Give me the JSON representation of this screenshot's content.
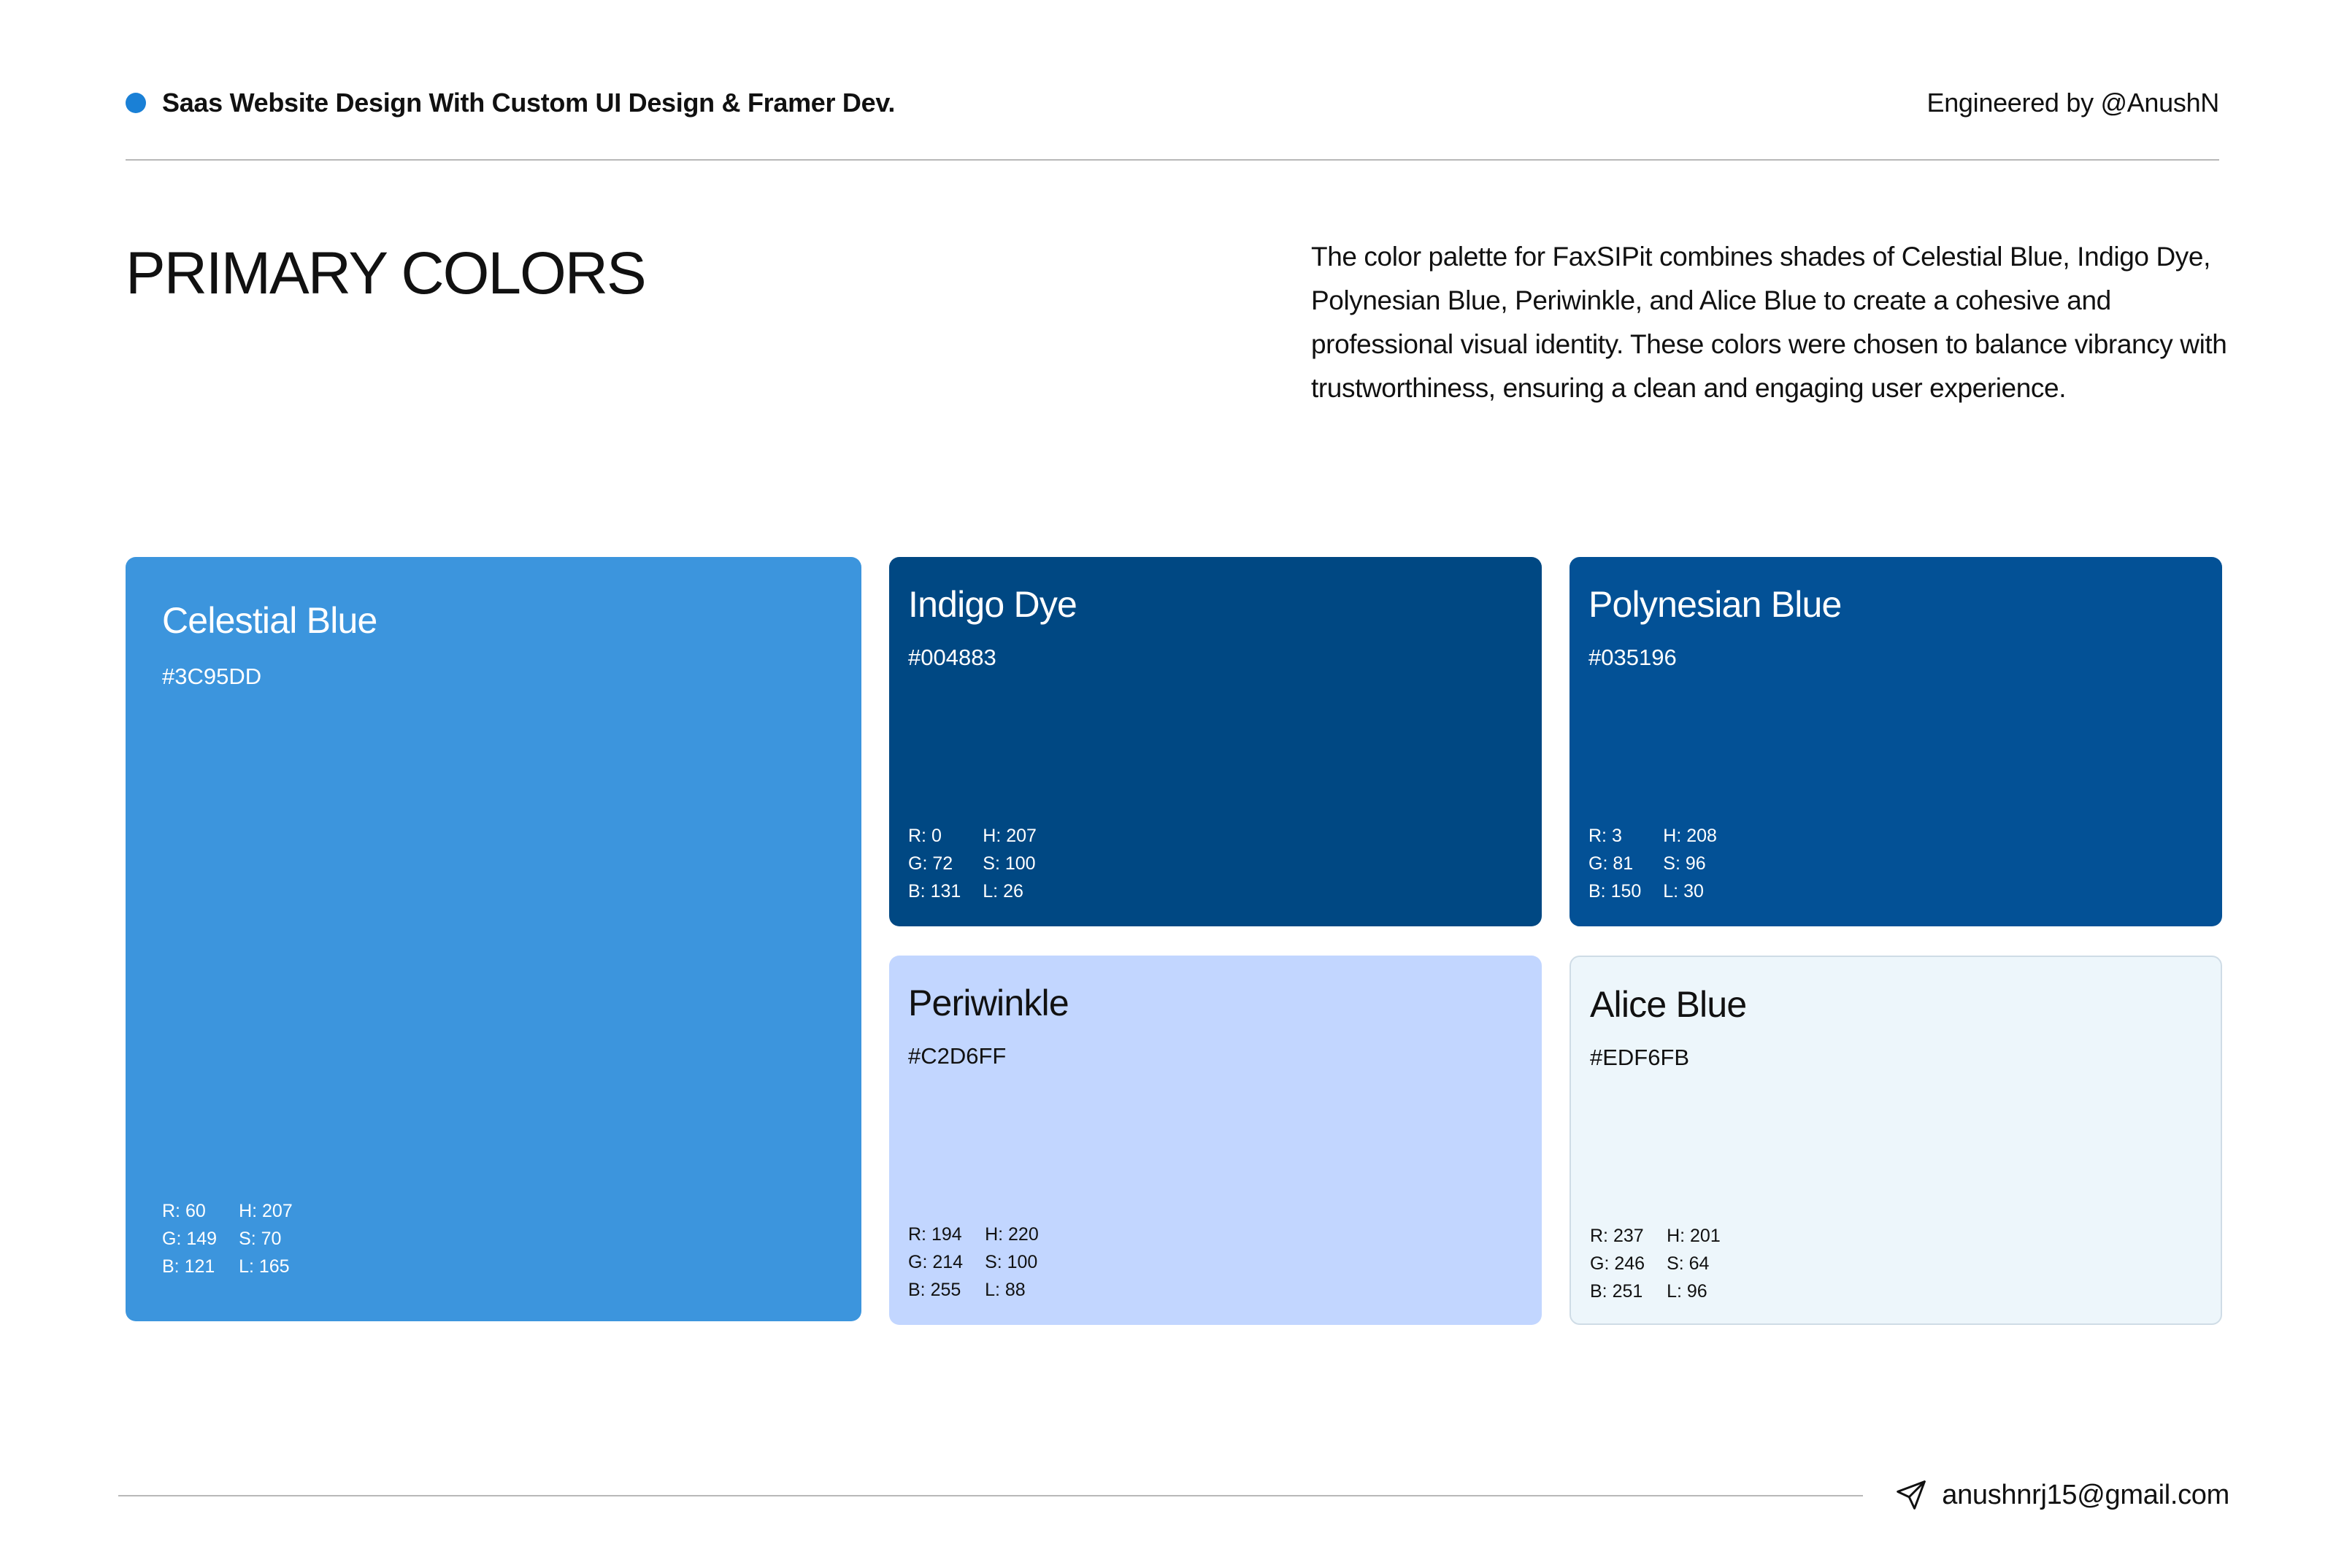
{
  "header": {
    "title": "Saas Website Design With Custom UI Design & Framer Dev.",
    "credit": "Engineered by @AnushN",
    "dot_color": "#1a80d6"
  },
  "section": {
    "title": "PRIMARY COLORS",
    "description": "The color palette for FaxSIPit combines shades of Celestial Blue, Indigo Dye, Polynesian Blue, Periwinkle, and Alice Blue to create a cohesive and professional visual identity. These colors were chosen to balance vibrancy with trustworthiness, ensuring a clean and engaging user experience."
  },
  "swatches": [
    {
      "name": "Celestial Blue",
      "hex": "#3C95DD",
      "values": [
        "R: 60",
        "H: 207",
        "G: 149",
        "S: 70",
        "B: 121",
        "L: 165"
      ]
    },
    {
      "name": "Indigo Dye",
      "hex": "#004883",
      "values": [
        "R: 0",
        "H: 207",
        "G: 72",
        "S: 100",
        "B: 131",
        "L: 26"
      ]
    },
    {
      "name": "Polynesian Blue",
      "hex": "#035196",
      "values": [
        "R: 3",
        "H: 208",
        "G: 81",
        "S: 96",
        "B: 150",
        "L: 30"
      ]
    },
    {
      "name": "Periwinkle",
      "hex": "#C2D6FF",
      "values": [
        "R: 194",
        "H: 220",
        "G: 214",
        "S: 100",
        "B: 255",
        "L: 88"
      ]
    },
    {
      "name": "Alice Blue",
      "hex": "#EDF6FB",
      "values": [
        "R: 237",
        "H: 201",
        "G: 246",
        "S: 64",
        "B: 251",
        "L: 96"
      ]
    }
  ],
  "footer": {
    "email": "anushnrj15@gmail.com",
    "icon": "send-icon"
  }
}
